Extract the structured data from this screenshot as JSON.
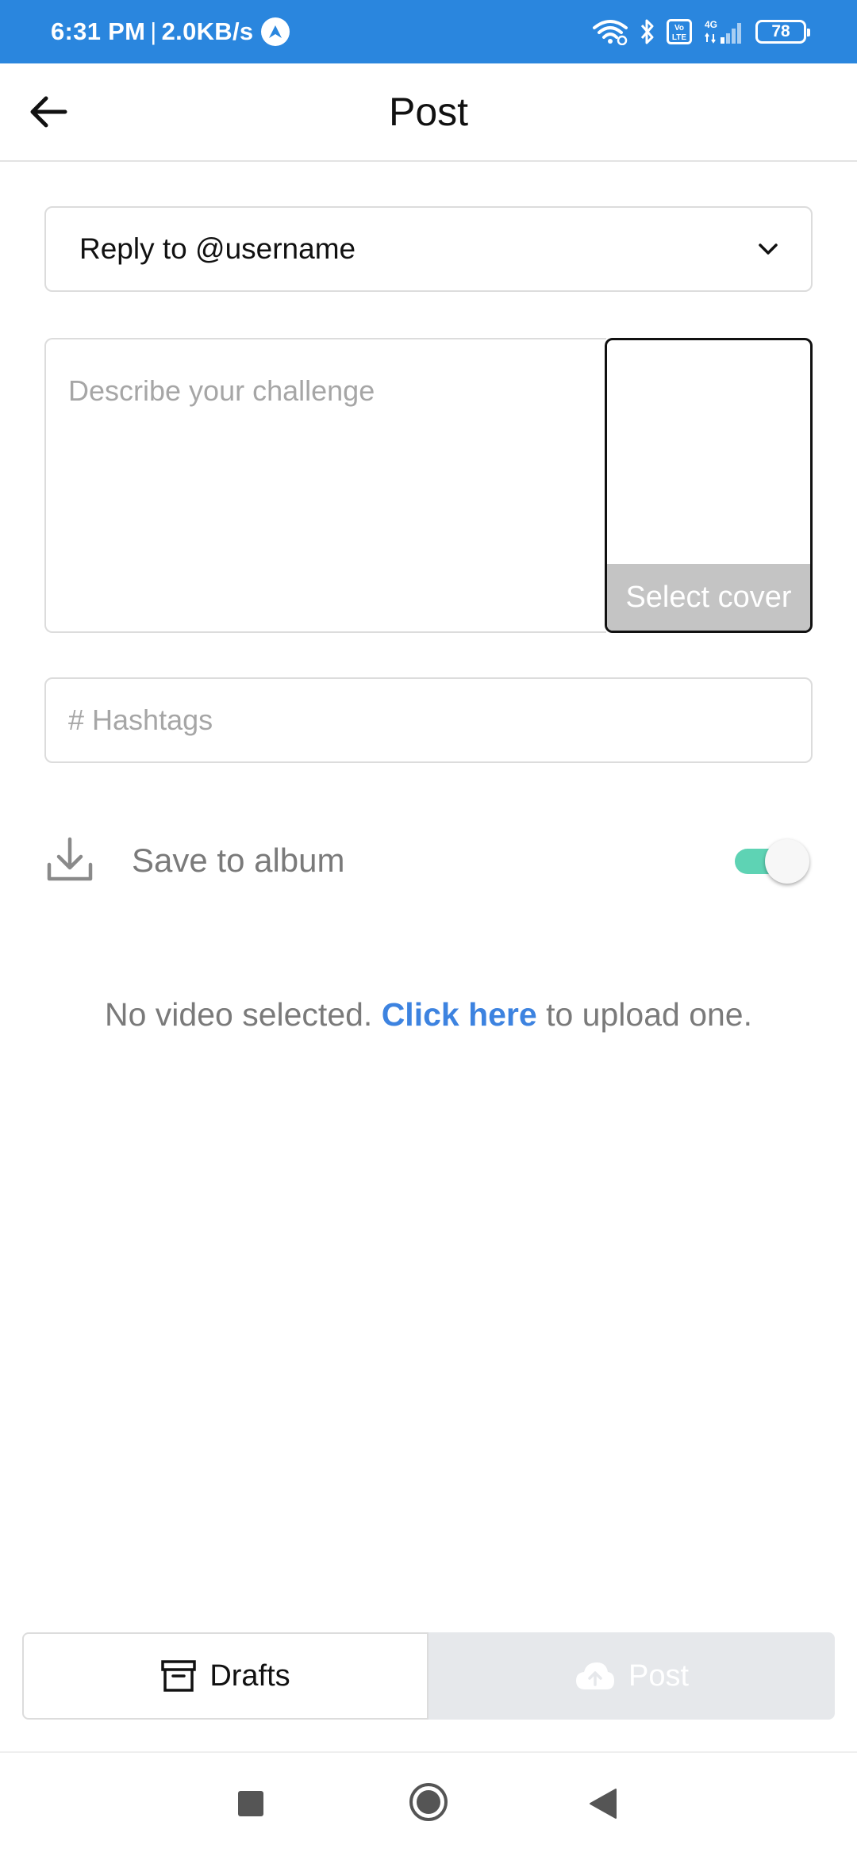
{
  "status_bar": {
    "time": "6:31 PM",
    "separator": "|",
    "network_speed": "2.0KB/s",
    "battery": "78",
    "network_type": "4G",
    "volte_label": "Vo LTE"
  },
  "header": {
    "title": "Post",
    "back_icon": "arrow-left-icon"
  },
  "form": {
    "reply_select_value": "Reply to @username",
    "description_placeholder": "Describe your challenge",
    "cover_label": "Select cover",
    "hashtags_placeholder": "# Hashtags",
    "save_to_album_label": "Save to album",
    "save_to_album_enabled": true
  },
  "upload_message": {
    "prefix": "No video selected. ",
    "link": "Click here",
    "suffix": " to upload one."
  },
  "bottom_bar": {
    "drafts_label": "Drafts",
    "post_label": "Post"
  },
  "colors": {
    "status_bar": "#2a86de",
    "link": "#3d83e0",
    "toggle_on": "#5ed3b4",
    "post_disabled_bg": "#e6e8eb"
  },
  "icons": {
    "download": "download-icon",
    "chevron": "chevron-down-icon",
    "drafts": "archive-box-icon",
    "post": "cloud-upload-icon"
  }
}
